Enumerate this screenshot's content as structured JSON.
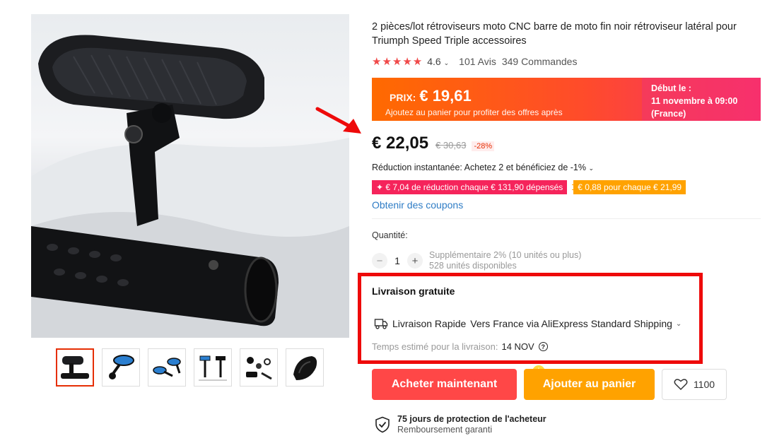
{
  "product": {
    "title": "2 pièces/lot rétroviseurs moto CNC barre de moto fin noir rétroviseur latéral pour Triumph Speed Triple accessoires",
    "rating": 4.6,
    "rating_text": "4.6",
    "stars": "★★★★★",
    "reviews": "101 Avis",
    "orders": "349 Commandes"
  },
  "promo": {
    "label": "PRIX:",
    "price": "€ 19,61",
    "note": "Ajoutez au panier pour profiter des offres après",
    "start_label": "Début le :",
    "start_date": "11 novembre à 09:00",
    "start_region": "(France)"
  },
  "price": {
    "current": "€ 22,05",
    "original": "€ 30,63",
    "discount": "-28%"
  },
  "discounts": {
    "instant": "Réduction instantanée: Achetez 2 et bénéficiez de -1%",
    "tag1": "✦ € 7,04 de réduction chaque € 131,90 dépensés",
    "tag2": "€ 0,88 pour chaque € 21,99",
    "coupon_link": "Obtenir des coupons"
  },
  "quantity": {
    "label": "Quantité:",
    "value": "1",
    "minus": "−",
    "plus": "+",
    "bulk_note": "Supplémentaire 2% (10 unités ou plus)",
    "available": "528 unités disponibles"
  },
  "shipping": {
    "title": "Livraison gratuite",
    "method": "Livraison Rapide",
    "carrier": "Vers France via AliExpress Standard Shipping",
    "eta_label": "Temps estimé pour la livraison:",
    "eta_date": "14 NOV",
    "help": "?"
  },
  "actions": {
    "buy_now": "Acheter maintenant",
    "add_to_cart": "Ajouter au panier",
    "wishlist_count": "1100"
  },
  "protection": {
    "title": "75 jours de protection de l'acheteur",
    "subtitle": "Remboursement garanti"
  },
  "colors": {
    "accent_red": "#ff4747",
    "accent_orange": "#ffa200",
    "highlight_box": "#ee0a0a",
    "link_blue": "#2e7cc5"
  },
  "icons": {
    "stars": "star-icon",
    "truck": "truck-icon",
    "help": "question-circle-icon",
    "wishlist": "heart-icon",
    "protection": "shield-check-icon",
    "annotation": "red-arrow-icon"
  }
}
